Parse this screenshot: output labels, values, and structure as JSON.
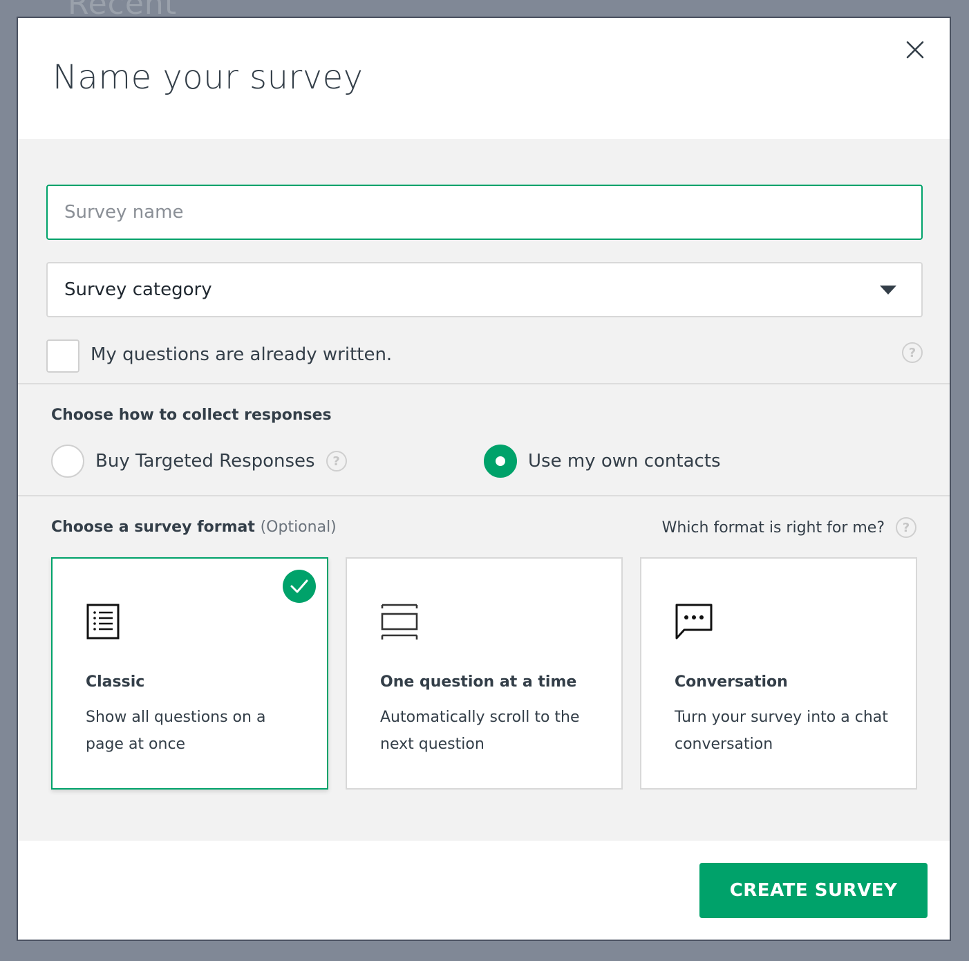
{
  "background": {
    "page_heading": "Recent"
  },
  "modal": {
    "title": "Name your survey",
    "close_icon": "close-icon"
  },
  "form": {
    "survey_name": {
      "value": "",
      "placeholder": "Survey name"
    },
    "survey_category": {
      "selected": "Survey category"
    },
    "questions_written": {
      "label": "My questions are already written.",
      "checked": false
    }
  },
  "collect": {
    "title": "Choose how to collect responses",
    "options": [
      {
        "label": "Buy Targeted Responses",
        "checked": false
      },
      {
        "label": "Use my own contacts",
        "checked": true
      }
    ]
  },
  "format": {
    "title": "Choose a survey format",
    "optional": "(Optional)",
    "help_link": "Which format is right for me?",
    "cards": [
      {
        "title": "Classic",
        "description": "Show all questions on a page at once",
        "selected": true,
        "icon": "list-document-icon"
      },
      {
        "title": "One question at a time",
        "description": "Automatically scroll to the next question",
        "selected": false,
        "icon": "stacked-rows-icon"
      },
      {
        "title": "Conversation",
        "description": "Turn your survey into a chat conversation",
        "selected": false,
        "icon": "chat-bubble-icon"
      }
    ]
  },
  "footer": {
    "create_label": "CREATE SURVEY"
  },
  "colors": {
    "accent": "#00a26a",
    "text": "#333e48",
    "panel": "#f2f2f2",
    "overlay": "#808896"
  }
}
